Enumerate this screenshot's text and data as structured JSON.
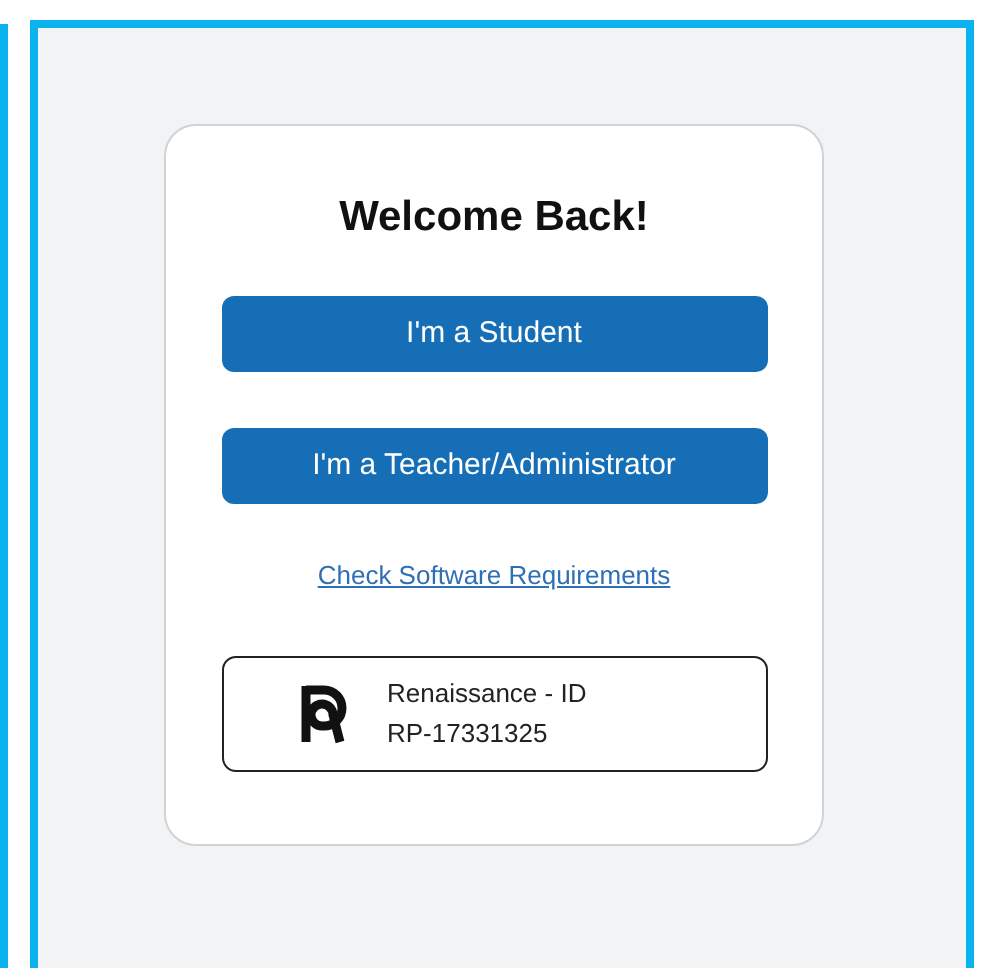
{
  "title": "Welcome Back!",
  "buttons": [
    {
      "label": "I'm a Student"
    },
    {
      "label": "I'm a Teacher/Administrator"
    }
  ],
  "link": "Check Software Requirements",
  "id_card": {
    "name": "Renaissance - ID",
    "code": "RP-17331325"
  }
}
